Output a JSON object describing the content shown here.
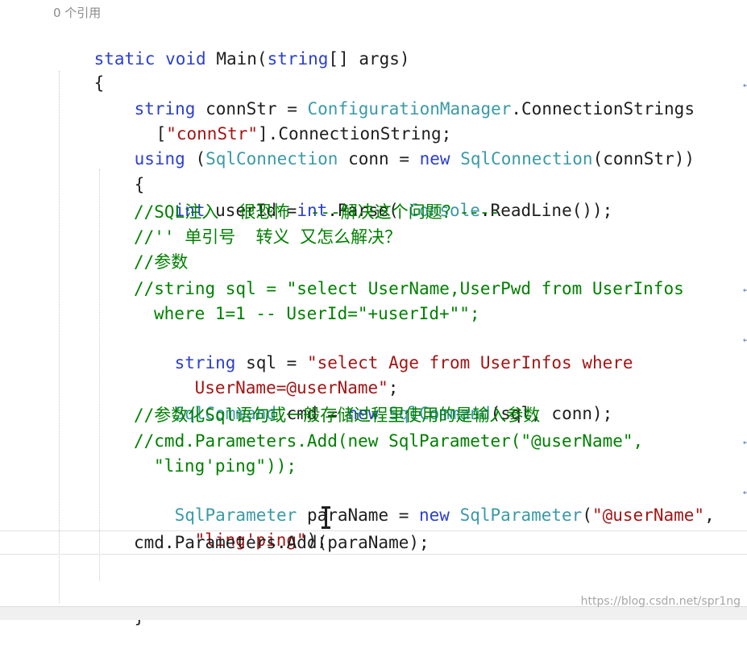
{
  "code_lens": "0 个引用",
  "lines": [
    [
      "static",
      " ",
      "void",
      " ",
      "Main",
      "(",
      "string",
      "[] args)"
    ],
    [
      "{"
    ],
    [
      "string",
      " connStr = ",
      "ConfigurationManager",
      ".ConnectionStrings"
    ],
    [
      "[",
      "\"connStr\"",
      "].ConnectionString;"
    ],
    [
      "using",
      " (",
      "SqlConnection",
      " conn = ",
      "new",
      " ",
      "SqlConnection",
      "(connStr))"
    ],
    [
      "{"
    ],
    [
      "int",
      " userId =",
      "int",
      ".Parse( ",
      "Console",
      ".ReadLine());"
    ],
    [
      "//SQL注入  很恐怖  ---解决这个问题？----"
    ],
    [
      "//'' 单引号  转义 又怎么解决？"
    ],
    [
      "//参数"
    ],
    [
      "//string sql = \"select UserName,UserPwd from UserInfos"
    ],
    [
      "where 1=1 -- UserId=\"+userId+\"\";"
    ],
    [
      "string",
      " sql = ",
      "\"select Age from UserInfos where"
    ],
    [
      "UserName=@userName\"",
      ";"
    ],
    [
      "SqlCommand",
      " cmd = ",
      "new",
      " ",
      "SqlCommand",
      "(sql, conn);"
    ],
    [
      "//参数化Sql语句或一般存储过程里使用的是输入参数"
    ],
    [
      "//cmd.Parameters.Add(new SqlParameter(\"@userName\","
    ],
    [
      "\"ling'ping\"));"
    ],
    [
      "SqlParameter",
      " paraName = ",
      "new",
      " ",
      "SqlParameter",
      "(",
      "\"@userName\"",
      ","
    ],
    [
      "\"ling'ping\"",
      ");"
    ],
    [
      "cmd.Parameters.Add(paraName);"
    ],
    [
      "}"
    ]
  ],
  "colors": {
    "keyword": "#2b3fd0",
    "type": "#3a9aa8",
    "string": "#a31515",
    "comment": "#008000",
    "plain": "#1e1e1e"
  },
  "watermark": "https://blog.csdn.net/spr1ng"
}
